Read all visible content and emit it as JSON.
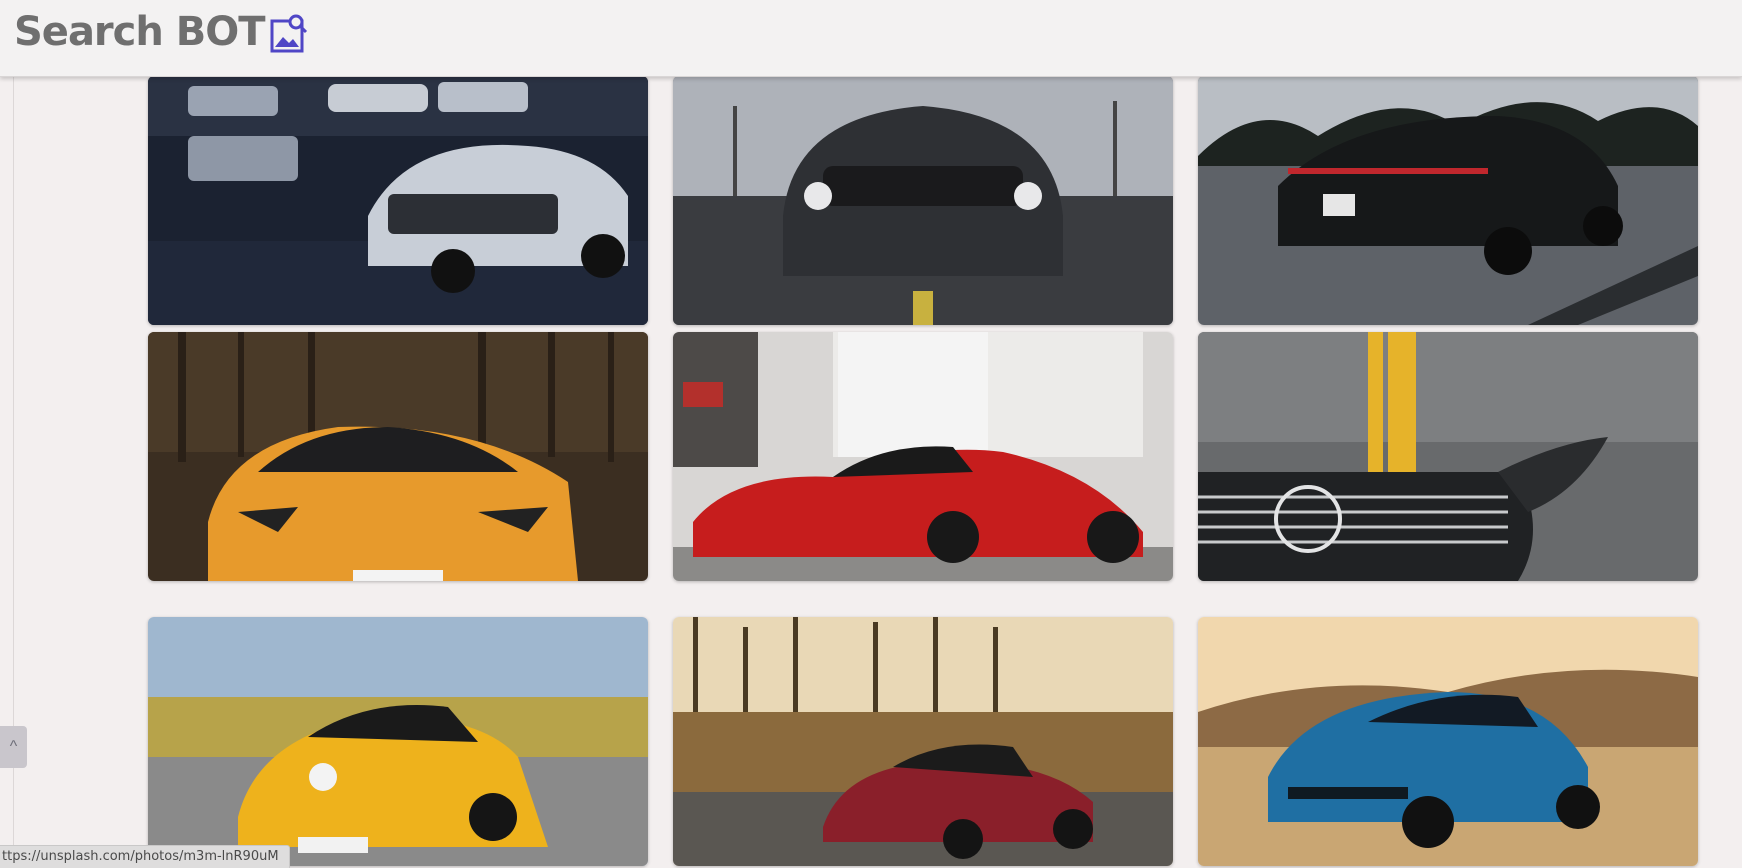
{
  "header": {
    "title": "Search BOT",
    "icon": "image-search-icon",
    "icon_color": "#4f46c6"
  },
  "gallery": {
    "images": [
      {
        "name": "car-image-1",
        "subject": "white camaro in garage"
      },
      {
        "name": "car-image-2",
        "subject": "black mustang front view"
      },
      {
        "name": "car-image-3",
        "subject": "black porsche panamera rear view"
      },
      {
        "name": "car-image-4",
        "subject": "orange lamborghini in forest"
      },
      {
        "name": "car-image-5",
        "subject": "red ferrari laferrari"
      },
      {
        "name": "car-image-6",
        "subject": "grey mercedes amg hood"
      },
      {
        "name": "car-image-7",
        "subject": "yellow mercedes amg gt"
      },
      {
        "name": "car-image-8",
        "subject": "red mercedes amg gt in woods"
      },
      {
        "name": "car-image-9",
        "subject": "blue camaro in desert"
      }
    ]
  },
  "scroll_top_button": {
    "icon": "chevron-up-icon",
    "label": "^"
  },
  "status_bar": {
    "url": "ttps://unsplash.com/photos/m3m-lnR90uM"
  }
}
